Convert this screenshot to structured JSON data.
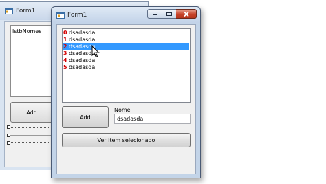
{
  "background_window": {
    "title": "Form1",
    "listbox_label": "lstbNomes",
    "add_button_label": "Add"
  },
  "window": {
    "title": "Form1",
    "caption_buttons": [
      "minimize-icon",
      "maximize-icon",
      "close-icon"
    ]
  },
  "listbox": {
    "items": [
      "dsadasda",
      "dsadasda",
      "dsadasda",
      "dsadasda",
      "dsadasda",
      "dsadasda"
    ],
    "selected_index": 2,
    "index_labels": [
      "0",
      "1",
      "2",
      "3",
      "4",
      "5"
    ]
  },
  "form": {
    "add_button_label": "Add",
    "nome_label": "Nome :",
    "nome_value": "dsadasda",
    "view_button_label": "Ver item selecionado"
  },
  "colors": {
    "selection": "#3399ff",
    "index_labels": "#d40000",
    "titlebar": "#c3d4e8",
    "close_button": "#c8442a"
  }
}
